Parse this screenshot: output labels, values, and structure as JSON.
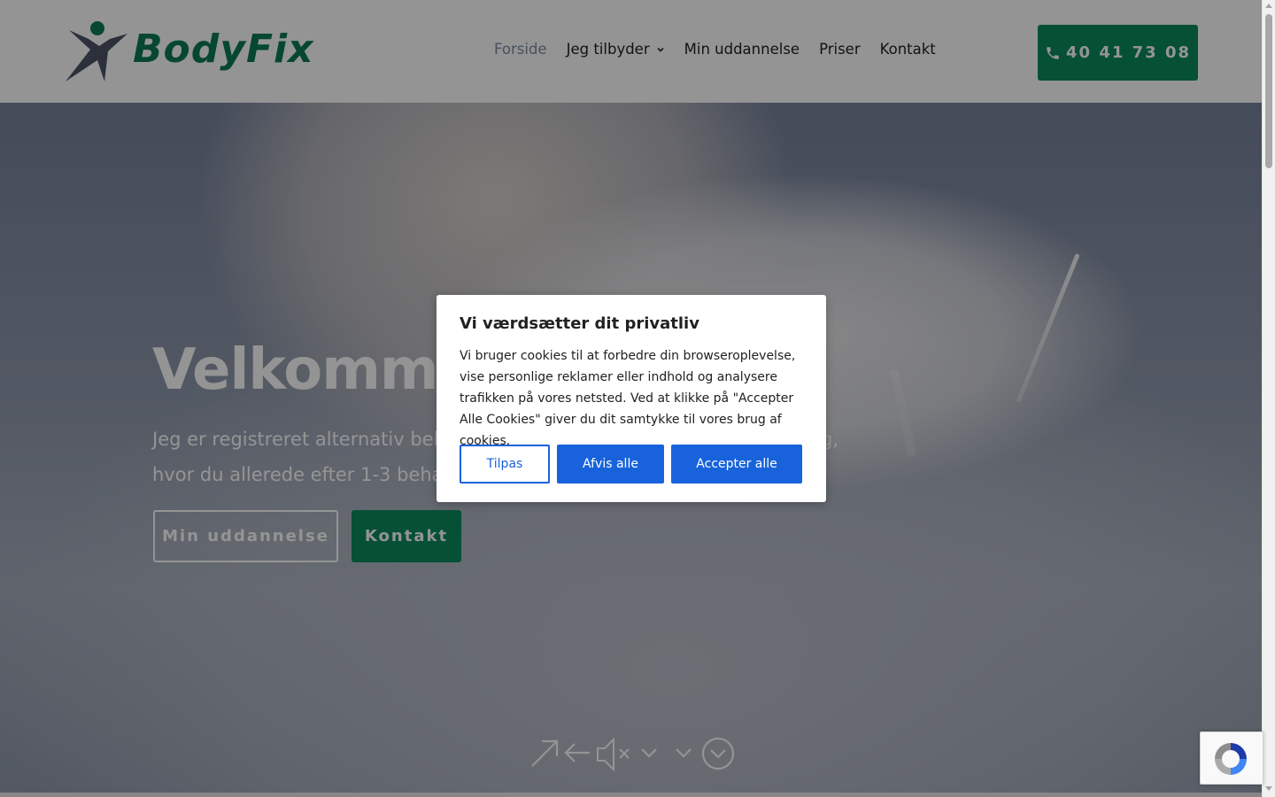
{
  "header": {
    "logo_text": "BodyFix",
    "nav": [
      {
        "label": "Forside",
        "active": true
      },
      {
        "label": "Jeg tilbyder",
        "has_dropdown": true
      },
      {
        "label": "Min uddannelse"
      },
      {
        "label": "Priser"
      },
      {
        "label": "Kontakt"
      }
    ],
    "phone_label": "40 41 73 08"
  },
  "hero": {
    "title_visible": "Velkommen",
    "subtitle_line1_left": "Jeg er registreret alternativ beh",
    "subtitle_line1_right": "g,",
    "subtitle_line2": "hvor du allerede efter 1-3 beha",
    "btn_education": "Min uddannelse",
    "btn_contact": "Kontakt"
  },
  "cookie_modal": {
    "title": "Vi værdsætter dit privatliv",
    "text": "Vi bruger cookies til at forbedre din browseroplevelse, vise personlige reklamer eller indhold og analysere trafikken på vores netsted. Ved at klikke på \"Accepter Alle Cookies\" giver du dit samtykke til vores brug af cookies.",
    "btn_customize": "Tilpas",
    "btn_reject": "Afvis alle",
    "btn_accept": "Accepter alle"
  },
  "colors": {
    "brand_green": "#0b8a5e",
    "consent_blue": "#1863dc",
    "overlay": "rgba(0,0,0,0.42)"
  },
  "icons": [
    "phone-icon",
    "chevron-down-icon",
    "fullscreen-icon",
    "back-arrow-icon",
    "mute-icon",
    "chevron-down-icon",
    "scroll-down-icon",
    "recaptcha-icon"
  ]
}
